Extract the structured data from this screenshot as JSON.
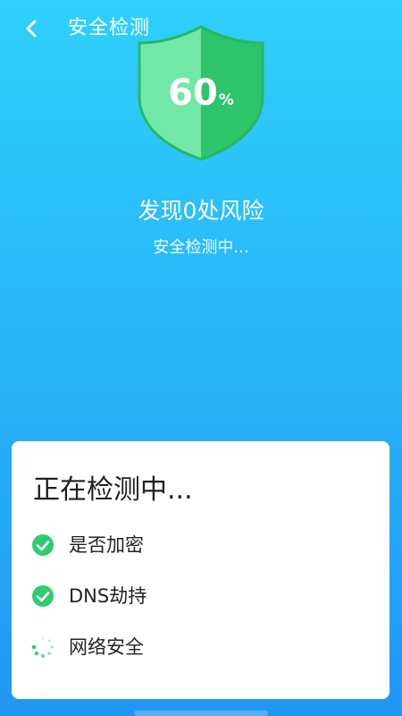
{
  "header": {
    "title": "安全检测",
    "back_icon": "chevron-left-icon"
  },
  "shield": {
    "progress_number": "60",
    "progress_unit": "%",
    "progress_value": 60,
    "colors": {
      "left": "#72e8a8",
      "right": "#2fc36b",
      "rim": "#25b863"
    }
  },
  "status": {
    "headline": "发现0处风险",
    "subline": "安全检测中..."
  },
  "card": {
    "title": "正在检测中...",
    "items": [
      {
        "label": "是否加密",
        "state": "done",
        "icon": "check-circle-icon"
      },
      {
        "label": "DNS劫持",
        "state": "done",
        "icon": "check-circle-icon"
      },
      {
        "label": "网络安全",
        "state": "loading",
        "icon": "spinner-icon"
      }
    ]
  },
  "colors": {
    "background_top": "#2fd0fb",
    "background_bottom": "#2196f3",
    "check_green": "#2ecc71",
    "card_bg": "#ffffff"
  }
}
